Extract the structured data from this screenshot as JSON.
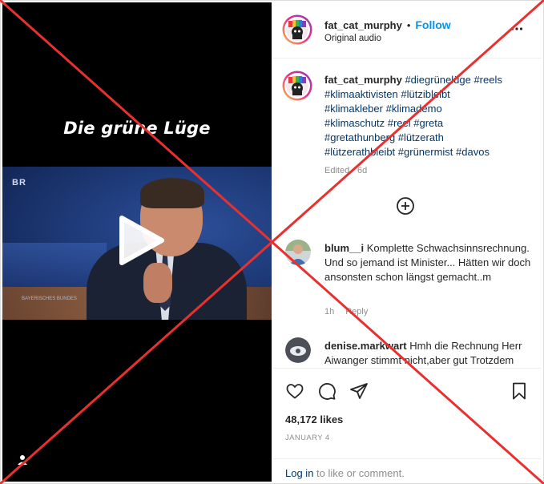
{
  "video": {
    "overlay_caption": "Die grüne Lüge",
    "channel_logo": "BR",
    "studio_text": "BAYERISCHES BUNDES"
  },
  "header": {
    "username": "fat_cat_murphy",
    "separator": "•",
    "follow_label": "Follow",
    "audio_label": "Original audio"
  },
  "caption": {
    "username": "fat_cat_murphy",
    "lines": [
      "#diegrünelüge #reels",
      "#klimaaktivisten #lützibleibt",
      "#klimakleber #klimademo",
      "#klimaschutz #reel #greta",
      "#gretathunberg #lützerath",
      "#lützerathbleibt #grünermist #davos"
    ],
    "edited": "Edited · 6d"
  },
  "comments": [
    {
      "username": "blum__i",
      "text": "Komplette Schwachsinnsrechnung. Und so jemand ist Minister... Hätten wir doch ansonsten schon längst gemacht..m",
      "time": "1h",
      "reply": "Reply"
    },
    {
      "username": "denise.markwart",
      "text": "Hmh die Rechnung Herr Aiwanger stimmt nicht,aber gut Trotzdem"
    }
  ],
  "actions": {
    "likes": "48,172 likes",
    "date": "JANUARY 4",
    "login_link": "Log in",
    "login_rest": " to like or comment."
  },
  "colors": {
    "accent_blue": "#0095f6",
    "hashtag_blue": "#00376b",
    "cross_red": "#e8312f"
  },
  "icons": [
    "play-icon",
    "sound-icon",
    "more-icon",
    "add-comment-icon",
    "heart-icon",
    "comment-icon",
    "share-icon",
    "bookmark-icon"
  ]
}
